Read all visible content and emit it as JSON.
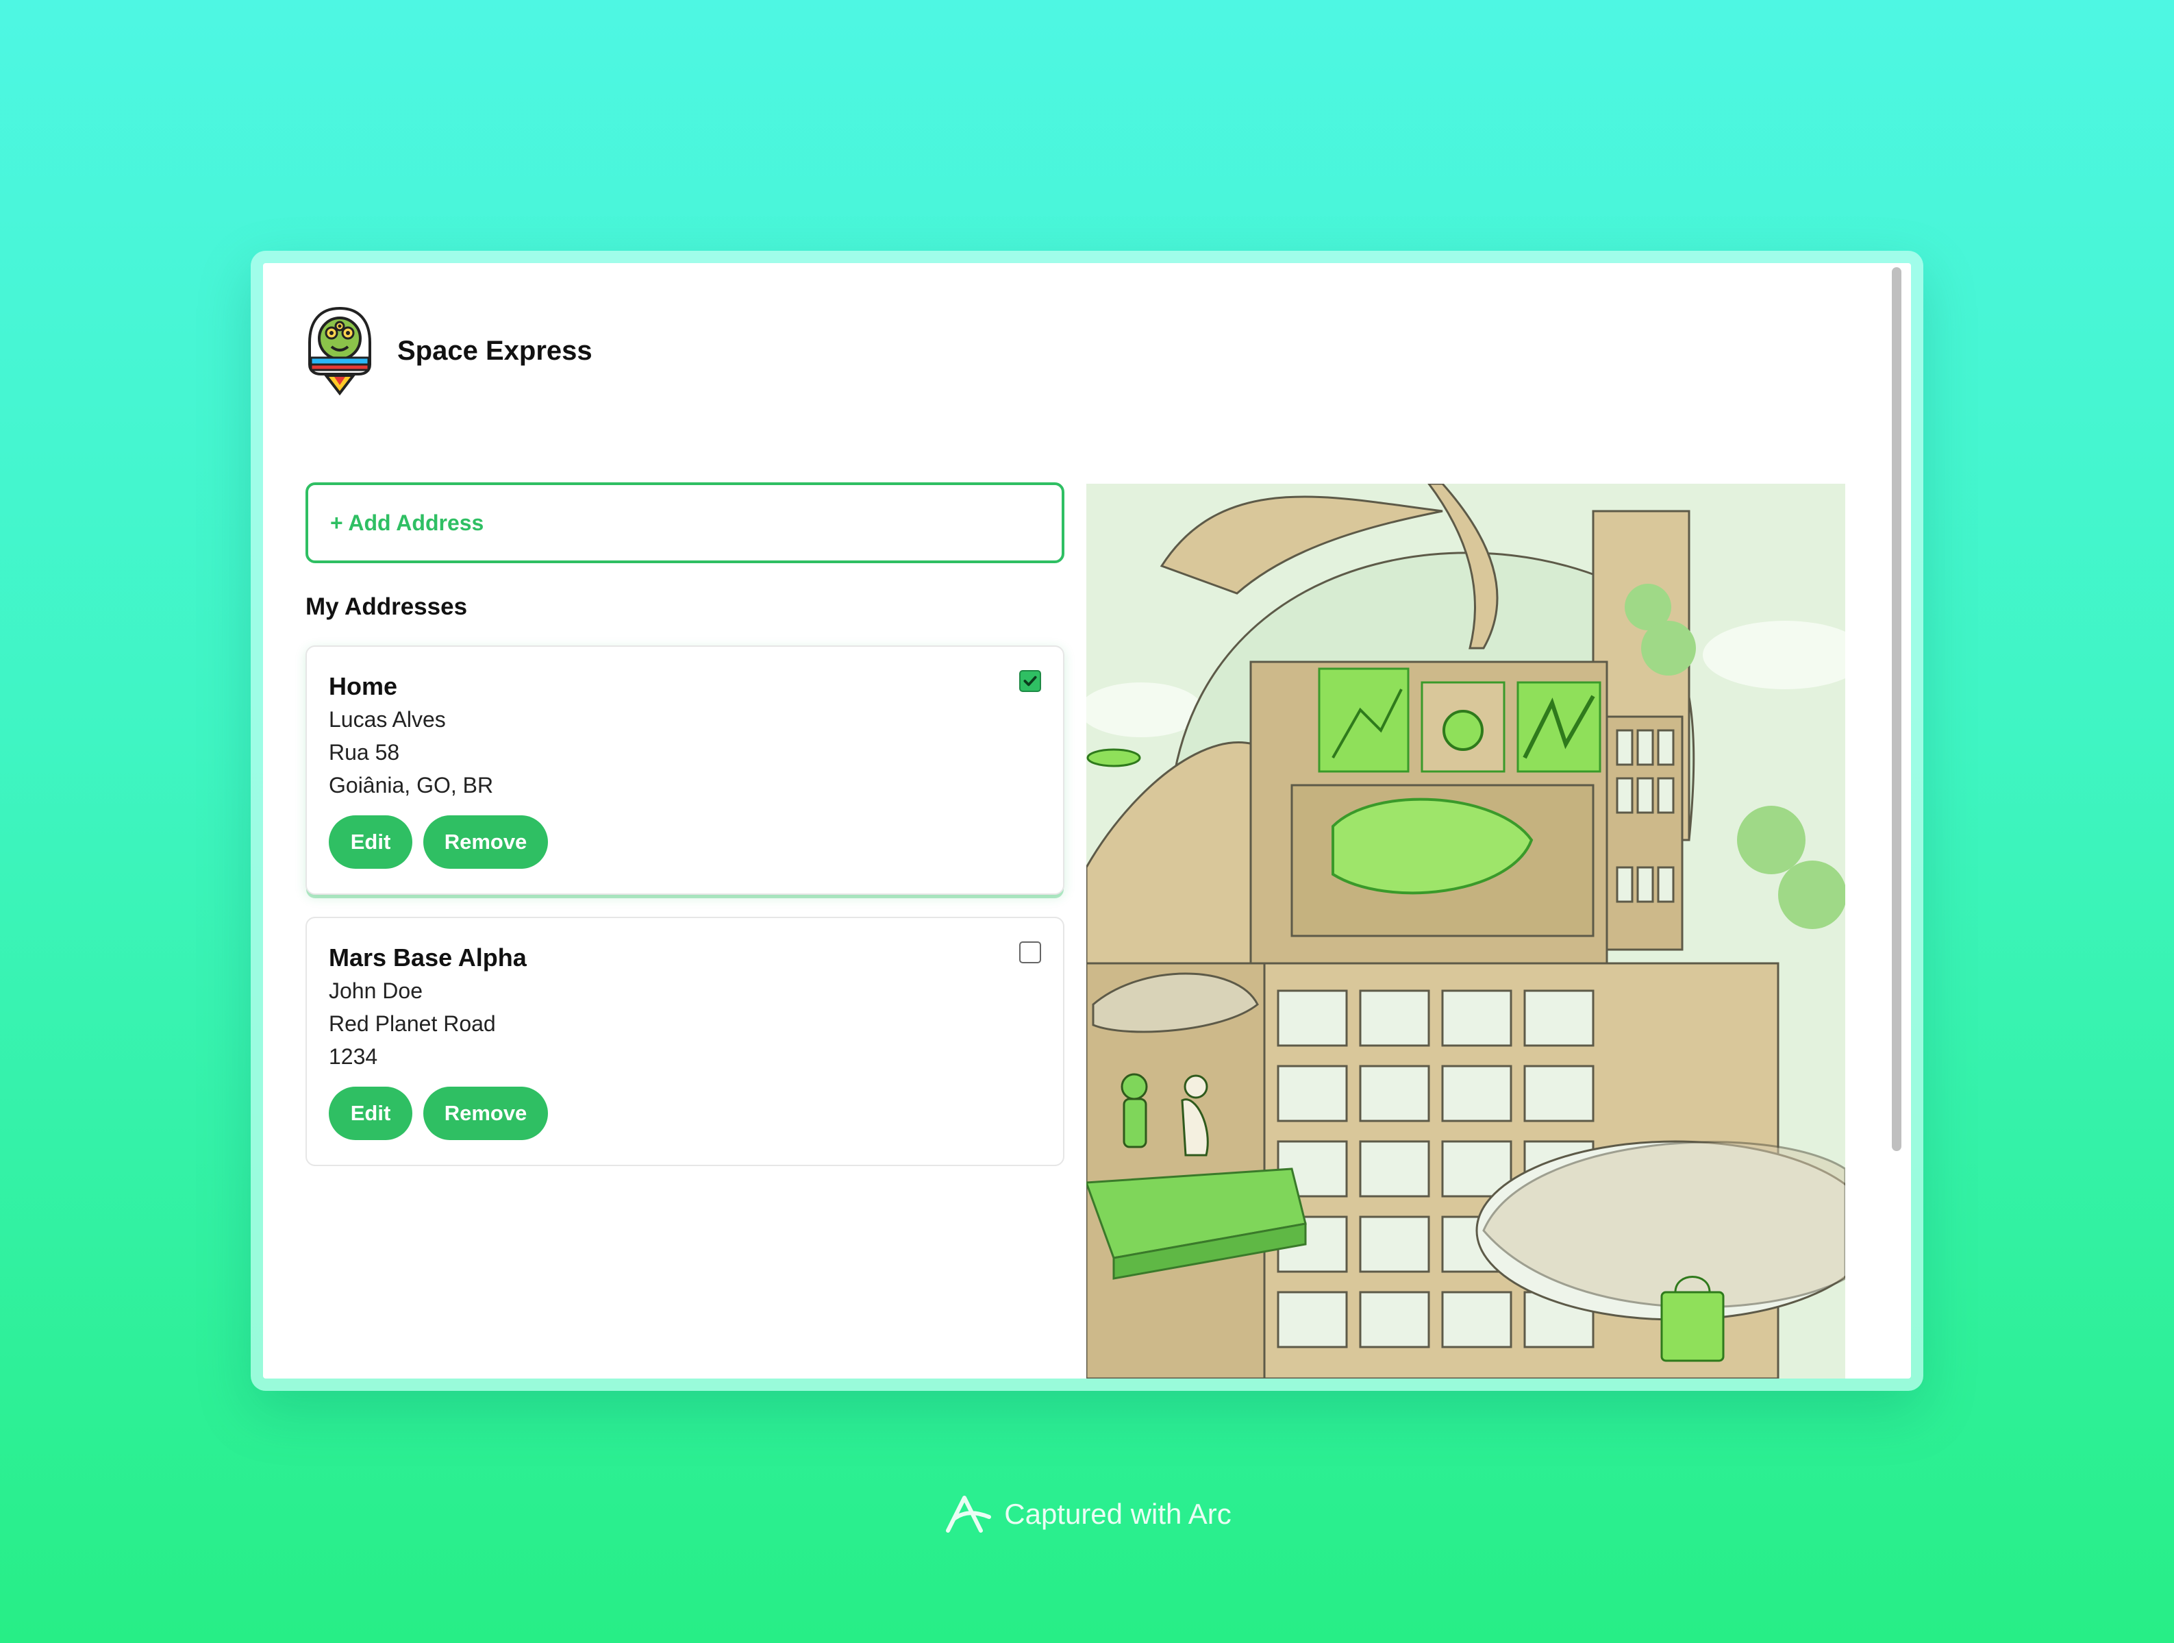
{
  "app": {
    "brand_name": "Space Express",
    "logo_icon": "alien-mascot-icon"
  },
  "main": {
    "add_address_label": "+ Add Address",
    "section_title": "My Addresses",
    "addresses": [
      {
        "title": "Home",
        "name": "Lucas Alves",
        "street": "Rua 58",
        "locality": "Goiânia, GO, BR",
        "selected": true,
        "edit_label": "Edit",
        "remove_label": "Remove"
      },
      {
        "title": "Mars Base Alpha",
        "name": "John Doe",
        "street": "Red Planet Road",
        "locality": "1234",
        "selected": false,
        "edit_label": "Edit",
        "remove_label": "Remove"
      }
    ]
  },
  "illustration": {
    "icon": "futuristic-city-illustration"
  },
  "footer": {
    "capture_label": "Captured with Arc",
    "icon": "arc-logo-icon"
  },
  "colors": {
    "accent": "#2fbf63",
    "bg_top": "#4ef7e3",
    "bg_bottom": "#27ee86"
  }
}
